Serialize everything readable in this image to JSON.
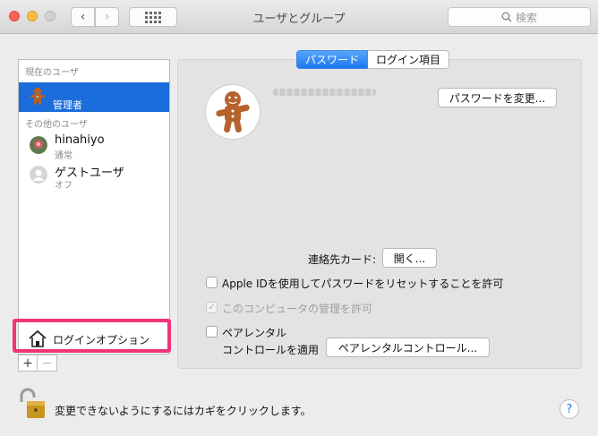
{
  "window": {
    "title": "ユーザとグループ"
  },
  "toolbar": {
    "search_placeholder": "検索",
    "back_glyph": "‹",
    "forward_glyph": "›"
  },
  "sidebar": {
    "current_section": "現在のユーザ",
    "current_user": {
      "role": "管理者",
      "avatar": "gingerbread-icon"
    },
    "other_section": "その他のユーザ",
    "others": [
      {
        "name": "hinahiyo",
        "sub": "通常",
        "avatar": "flower-avatar"
      },
      {
        "name": "ゲストユーザ",
        "sub": "オフ",
        "avatar": "generic-user-icon"
      }
    ],
    "login_options": "ログインオプション",
    "add": "+",
    "remove": "−"
  },
  "tabs": {
    "password": "パスワード",
    "login_items": "ログイン項目",
    "active": "password"
  },
  "main": {
    "change_password": "パスワードを変更...",
    "contact_card_label": "連絡先カード:",
    "open_button": "開く...",
    "apple_id_reset": "Apple IDを使用してパスワードをリセットすることを許可",
    "allow_admin": "このコンピュータの管理を許可",
    "parental_line1": "ペアレンタル",
    "parental_line2": "コントロールを適用",
    "parental_button": "ペアレンタルコントロール..."
  },
  "footer": {
    "lock_text": "変更できないようにするにはカギをクリックします。",
    "help": "?"
  },
  "colors": {
    "selection": "#1a6ddb",
    "highlight_box": "#f0347a",
    "tab_active": "#1a78f0"
  }
}
